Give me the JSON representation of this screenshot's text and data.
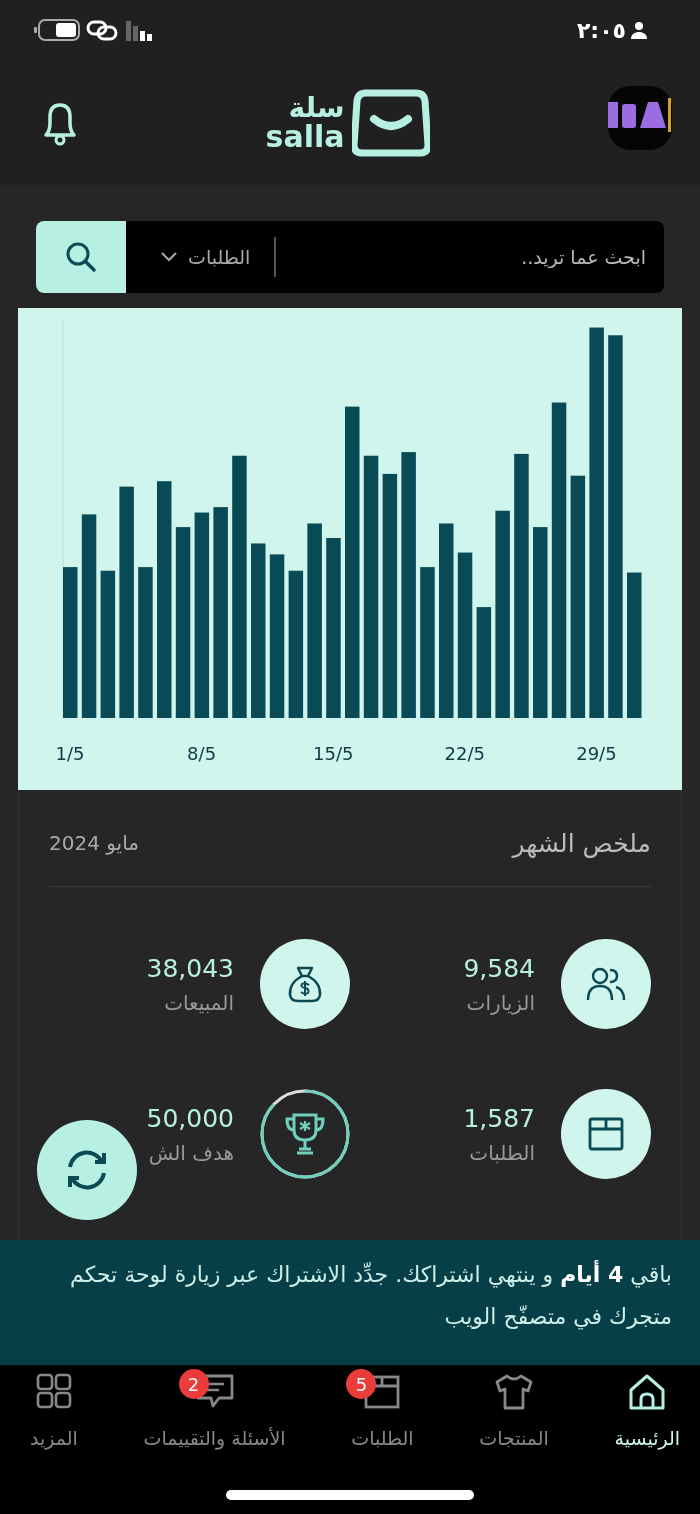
{
  "status_bar": {
    "time": "٢:٠٥"
  },
  "header": {
    "logo_arabic": "سلة",
    "logo_latin": "salla"
  },
  "search": {
    "placeholder": "ابحث عما تريد..",
    "scope": "الطلبات"
  },
  "chart": {
    "x_labels": [
      "29/5",
      "22/5",
      "15/5",
      "8/5",
      "1/5"
    ]
  },
  "summary": {
    "title": "ملخص الشهر",
    "period": "مايو 2024",
    "stats": [
      {
        "kind": "visits",
        "value": "9,584",
        "label": "الزيارات"
      },
      {
        "kind": "sales",
        "value": "38,043",
        "label": "المبيعات"
      },
      {
        "kind": "orders",
        "value": "1,587",
        "label": "الطلبات"
      },
      {
        "kind": "goal",
        "value": "50,000",
        "label": "هدف الش"
      }
    ]
  },
  "banner": {
    "text": "باقي **4 أيام** و ينتهي اشتراكك. جدِّد الاشتراك عبر زيارة لوحة تحكم متجرك في متصفّح الويب"
  },
  "nav": [
    {
      "kind": "home",
      "label": "الرئيسية",
      "selected": true
    },
    {
      "kind": "products",
      "label": "المنتجات",
      "selected": false
    },
    {
      "kind": "orders",
      "label": "الطلبات",
      "selected": false,
      "badge": "5"
    },
    {
      "kind": "reviews",
      "label": "الأسئلة والتقييمات",
      "selected": false,
      "badge": "2"
    },
    {
      "kind": "more",
      "label": "المزيد",
      "selected": false
    }
  ]
}
